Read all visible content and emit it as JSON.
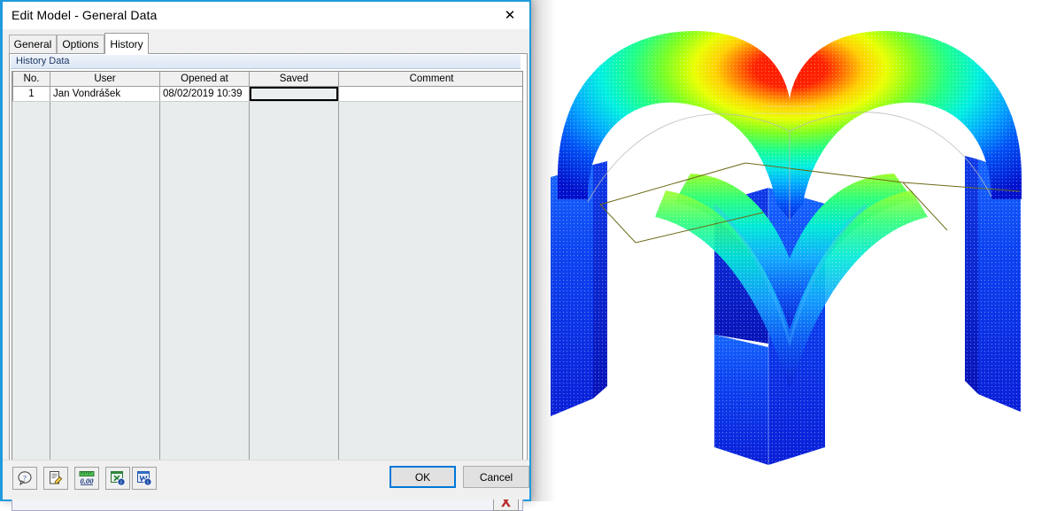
{
  "window": {
    "title": "Edit Model - General Data",
    "close_label": "✕"
  },
  "tabs": [
    {
      "label": "General",
      "active": false
    },
    {
      "label": "Options",
      "active": false
    },
    {
      "label": "History",
      "active": true
    }
  ],
  "group": {
    "header": "History Data"
  },
  "table": {
    "columns": [
      "No.",
      "User",
      "Opened at",
      "Saved",
      "Comment"
    ],
    "rows": [
      {
        "no": "1",
        "user": "Jan Vondrášek",
        "opened_at": "08/02/2019 10:39",
        "saved": "",
        "comment": ""
      }
    ]
  },
  "table_footer": {
    "delete_label": "✖"
  },
  "toolbar": [
    {
      "name": "help-button",
      "icon": "question-mark-bubble-icon"
    },
    {
      "name": "edit-comment-button",
      "icon": "document-pencil-icon"
    },
    {
      "name": "number-format-button",
      "icon": "decimal-places-icon",
      "text": "0.00"
    },
    {
      "name": "export-excel-button",
      "icon": "excel-export-icon",
      "text": "X"
    },
    {
      "name": "export-word-button",
      "icon": "word-export-icon",
      "text": "W"
    }
  ],
  "buttons": {
    "ok": "OK",
    "cancel": "Cancel"
  },
  "colors": {
    "window_border": "#1f9bdd",
    "accent_focus": "#0078d7",
    "group_header_text": "#1f3864",
    "grid_background": "#e8ecec",
    "delete_icon": "#c0392b"
  },
  "viewport": {
    "model": "groin-vault-fem-deformation",
    "contour_scale": [
      "#0000cd",
      "#0055ff",
      "#00b7ff",
      "#00ffd5",
      "#4cff3a",
      "#c6ff00",
      "#ffe000",
      "#ff8c00",
      "#ff1a00"
    ]
  }
}
